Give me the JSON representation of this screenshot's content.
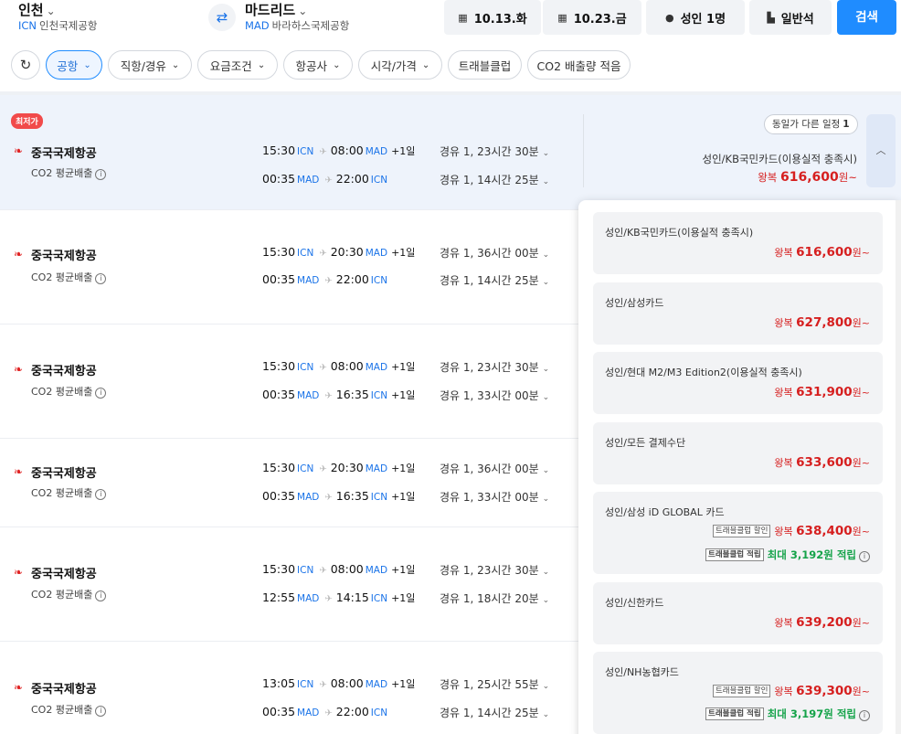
{
  "header": {
    "origin": {
      "city": "인천",
      "code": "ICN",
      "airport": "인천국제공항"
    },
    "destination": {
      "city": "마드리드",
      "code": "MAD",
      "airport": "바라하스국제공항"
    },
    "swap_icon": "swap-arrows-icon",
    "depart_date": "10.13.화",
    "return_date": "10.23.금",
    "passengers": "성인 1명",
    "cabin": "일반석",
    "search_label": "검색"
  },
  "filters": [
    "공항",
    "직항/경유",
    "요금조건",
    "항공사",
    "시각/가격",
    "트래블클럽",
    "CO2 배출량 적음"
  ],
  "results": [
    {
      "badge": "최저가",
      "airline": "중국국제항공",
      "co2": "CO2 평균배출",
      "out": {
        "dep": "15:30",
        "dep_code": "ICN",
        "arr": "08:00",
        "arr_code": "MAD",
        "plus": "+1일",
        "stop": "경유 1, 23시간 30분"
      },
      "ret": {
        "dep": "00:35",
        "dep_code": "MAD",
        "arr": "22:00",
        "arr_code": "ICN",
        "plus": "",
        "stop": "경유 1, 14시간 25분"
      }
    },
    {
      "airline": "중국국제항공",
      "co2": "CO2 평균배출",
      "out": {
        "dep": "15:30",
        "dep_code": "ICN",
        "arr": "20:30",
        "arr_code": "MAD",
        "plus": "+1일",
        "stop": "경유 1, 36시간 00분"
      },
      "ret": {
        "dep": "00:35",
        "dep_code": "MAD",
        "arr": "22:00",
        "arr_code": "ICN",
        "plus": "",
        "stop": "경유 1, 14시간 25분"
      }
    },
    {
      "airline": "중국국제항공",
      "co2": "CO2 평균배출",
      "out": {
        "dep": "15:30",
        "dep_code": "ICN",
        "arr": "08:00",
        "arr_code": "MAD",
        "plus": "+1일",
        "stop": "경유 1, 23시간 30분"
      },
      "ret": {
        "dep": "00:35",
        "dep_code": "MAD",
        "arr": "16:35",
        "arr_code": "ICN",
        "plus": "+1일",
        "stop": "경유 1, 33시간 00분"
      }
    },
    {
      "airline": "중국국제항공",
      "co2": "CO2 평균배출",
      "out": {
        "dep": "15:30",
        "dep_code": "ICN",
        "arr": "20:30",
        "arr_code": "MAD",
        "plus": "+1일",
        "stop": "경유 1, 36시간 00분"
      },
      "ret": {
        "dep": "00:35",
        "dep_code": "MAD",
        "arr": "16:35",
        "arr_code": "ICN",
        "plus": "+1일",
        "stop": "경유 1, 33시간 00분"
      }
    },
    {
      "airline": "중국국제항공",
      "co2": "CO2 평균배출",
      "out": {
        "dep": "15:30",
        "dep_code": "ICN",
        "arr": "08:00",
        "arr_code": "MAD",
        "plus": "+1일",
        "stop": "경유 1, 23시간 30분"
      },
      "ret": {
        "dep": "12:55",
        "dep_code": "MAD",
        "arr": "14:15",
        "arr_code": "ICN",
        "plus": "+1일",
        "stop": "경유 1, 18시간 20분"
      }
    },
    {
      "airline": "중국국제항공",
      "co2": "CO2 평균배출",
      "out": {
        "dep": "13:05",
        "dep_code": "ICN",
        "arr": "08:00",
        "arr_code": "MAD",
        "plus": "+1일",
        "stop": "경유 1, 25시간 55분"
      },
      "ret": {
        "dep": "00:35",
        "dep_code": "MAD",
        "arr": "22:00",
        "arr_code": "ICN",
        "plus": "",
        "stop": "경유 1, 14시간 25분"
      }
    }
  ],
  "first_fare": {
    "same_day_label": "동일가 다른 일정",
    "same_day_count": "1",
    "label": "성인/KB국민카드(이용실적 충족시)",
    "price_prefix": "왕복",
    "price": "616,600",
    "price_suffix": "원~"
  },
  "fare_options": [
    {
      "label": "성인/KB국민카드(이용실적 충족시)",
      "prefix": "왕복",
      "price": "616,600",
      "suffix": "원~"
    },
    {
      "label": "성인/삼성카드",
      "prefix": "왕복",
      "price": "627,800",
      "suffix": "원~"
    },
    {
      "label": "성인/현대 M2/M3 Edition2(이용실적 충족시)",
      "prefix": "왕복",
      "price": "631,900",
      "suffix": "원~"
    },
    {
      "label": "성인/모든 결제수단",
      "prefix": "왕복",
      "price": "633,600",
      "suffix": "원~"
    },
    {
      "label": "성인/삼성 iD GLOBAL 카드",
      "prefix": "왕복",
      "price": "638,400",
      "suffix": "원~",
      "discount_tag": "트래블클럽 할인",
      "accrual_tag": "트래블클럽 적립",
      "accrual": "최대 3,192원 적립"
    },
    {
      "label": "성인/신한카드",
      "prefix": "왕복",
      "price": "639,200",
      "suffix": "원~"
    },
    {
      "label": "성인/NH농협카드",
      "prefix": "왕복",
      "price": "639,300",
      "suffix": "원~",
      "discount_tag": "트래블클럽 할인",
      "accrual_tag": "트래블클럽 적립",
      "accrual": "최대 3,197원 적립"
    }
  ]
}
